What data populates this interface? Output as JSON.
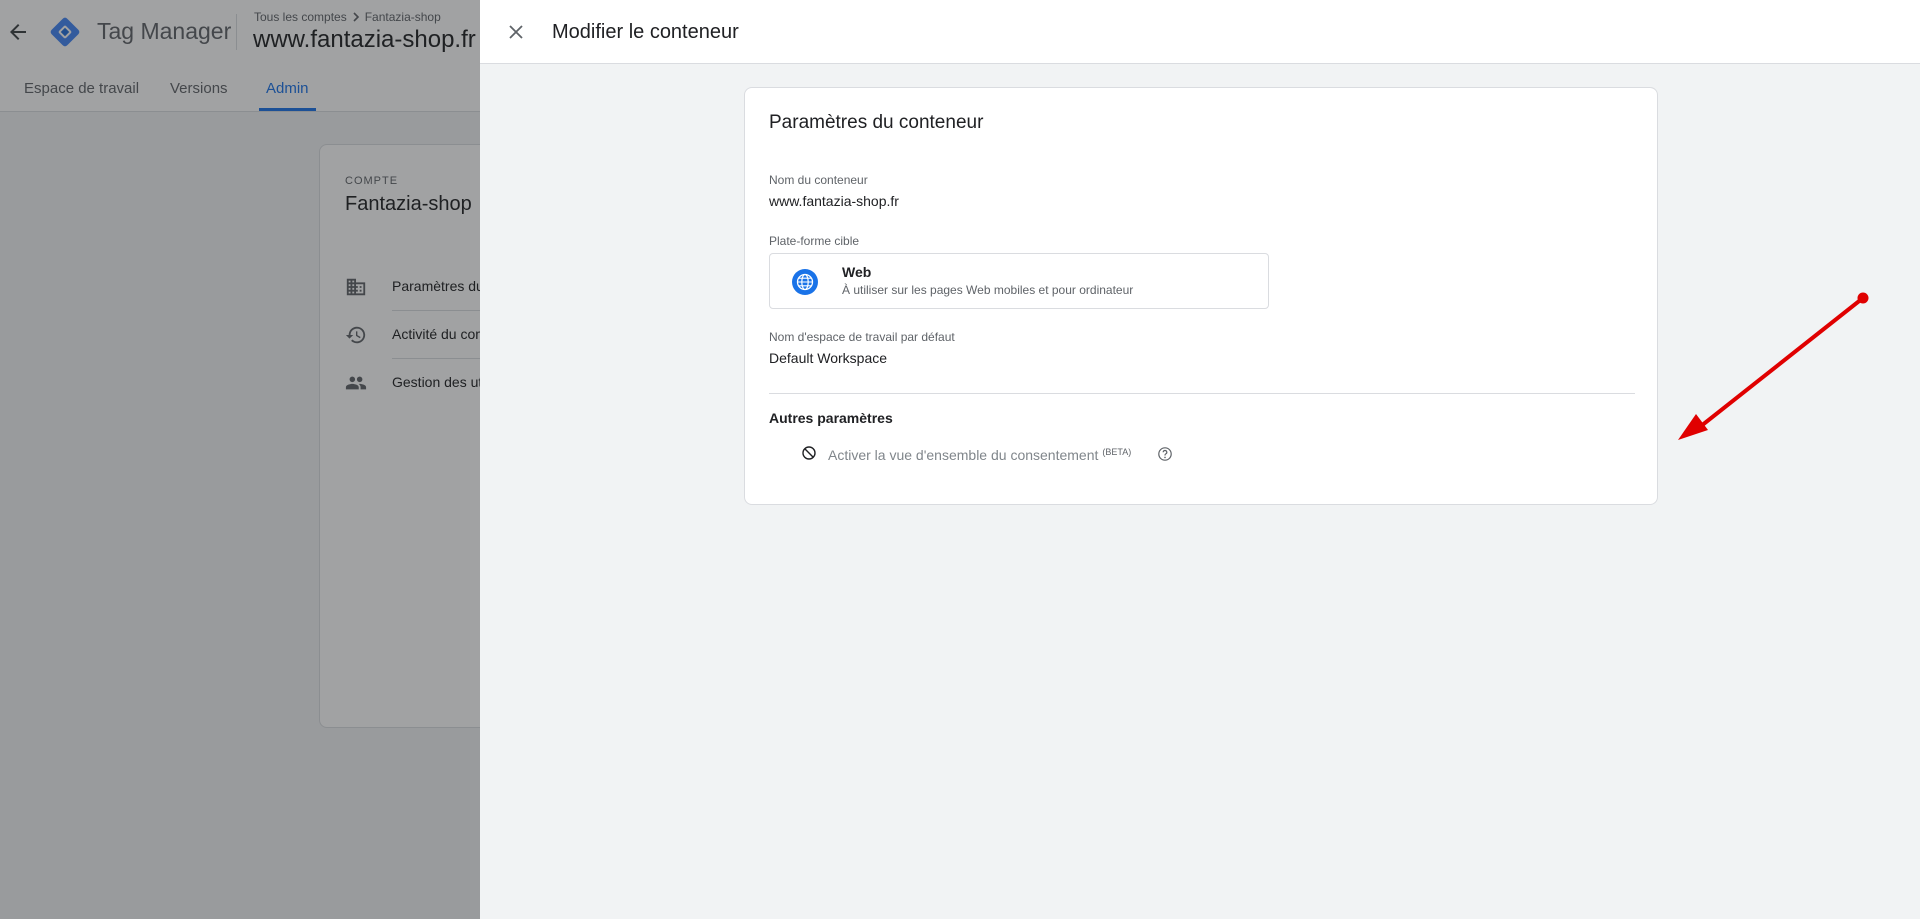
{
  "app": {
    "title": "Tag Manager",
    "breadcrumb": {
      "accounts": "Tous les comptes",
      "account": "Fantazia-shop"
    },
    "container_name": "www.fantazia-shop.fr"
  },
  "tabs": [
    {
      "label": "Espace de travail"
    },
    {
      "label": "Versions"
    },
    {
      "label": "Admin",
      "active": true
    }
  ],
  "account_panel": {
    "section_label": "COMPTE",
    "name": "Fantazia-shop",
    "items": [
      {
        "label": "Paramètres du compte",
        "icon": "building-icon"
      },
      {
        "label": "Activité du compte",
        "icon": "history-icon"
      },
      {
        "label": "Gestion des utilisateurs",
        "icon": "people-icon"
      }
    ]
  },
  "sheet": {
    "title": "Modifier le conteneur",
    "card": {
      "title": "Paramètres du conteneur",
      "container_name_label": "Nom du conteneur",
      "container_name_value": "www.fantazia-shop.fr",
      "platform_label": "Plate-forme cible",
      "platform": {
        "name": "Web",
        "description": "À utiliser sur les pages Web mobiles et pour ordinateur",
        "icon": "globe-icon"
      },
      "workspace_label": "Nom d'espace de travail par défaut",
      "workspace_value": "Default Workspace",
      "other_settings_title": "Autres paramètres",
      "consent_option": {
        "label": "Activer la vue d'ensemble du consentement",
        "badge": "(BETA)",
        "enabled": false
      }
    }
  },
  "colors": {
    "accent": "#1a73e8",
    "annotation_arrow": "#e00000",
    "sheet_background": "#f1f3f4"
  }
}
